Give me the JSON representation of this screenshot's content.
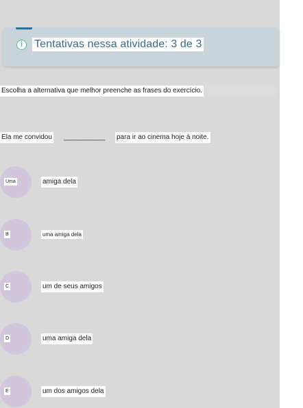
{
  "info": {
    "attempts_text": "Tentativas nessa atividade: 3 de 3",
    "icon": "info-icon"
  },
  "question": {
    "instruction": "Escolha a alternativa que melhor preenche as frases do exercício.",
    "sentence_before": "Ela me convidou",
    "blank": "____________",
    "sentence_after": "para ir ao cinema hoje à noite."
  },
  "options": [
    {
      "letter": "Uma",
      "text": "amiga dela"
    },
    {
      "letter": "B",
      "text": "uma amiga dela"
    },
    {
      "letter": "C",
      "text": "um de seus amigos"
    },
    {
      "letter": "D",
      "text": "uma amiga dela"
    },
    {
      "letter": "E",
      "text": "um dos amigos dela"
    }
  ],
  "colors": {
    "background": "#d9d9d9",
    "info_card": "#c9d4da",
    "accent": "#2c6f9e",
    "info_icon": "#5bb5a6",
    "option_circle": "#d1c6dc"
  }
}
